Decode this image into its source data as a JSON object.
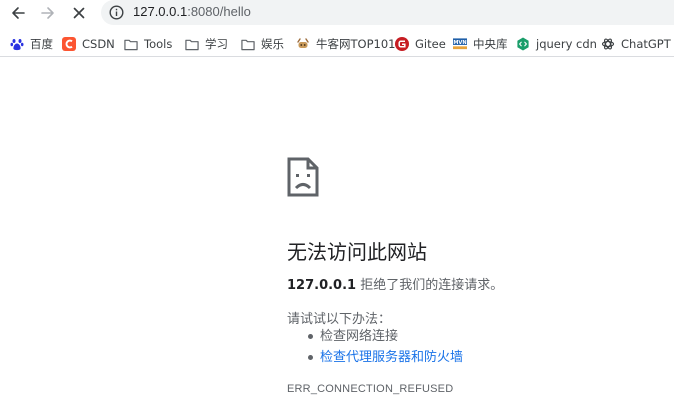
{
  "browser": {
    "url_host": "127.0.0.1",
    "url_port_path": ":8080/hello"
  },
  "bookmarks": [
    {
      "label": "百度",
      "icon": "baidu-paw-icon",
      "color": "#2932e1"
    },
    {
      "label": "CSDN",
      "icon": "csdn-logo-icon",
      "color": "#fc5531"
    },
    {
      "label": "Tools",
      "icon": "folder-icon",
      "color": "#5f6368"
    },
    {
      "label": "学习",
      "icon": "folder-icon",
      "color": "#5f6368"
    },
    {
      "label": "娱乐",
      "icon": "folder-icon",
      "color": "#5f6368"
    },
    {
      "label": "牛客网TOP101",
      "icon": "nowcoder-icon",
      "color": "#9c6b3b"
    },
    {
      "label": "Gitee",
      "icon": "gitee-logo-icon",
      "color": "#c71d23"
    },
    {
      "label": "中央库",
      "icon": "maven-logo-icon",
      "color": "#1f5fa8"
    },
    {
      "label": "jquery cdn",
      "icon": "jquery-cdn-icon",
      "color": "#1a9e6a"
    },
    {
      "label": "ChatGPT",
      "icon": "chatgpt-logo-icon",
      "color": "#3c4043"
    }
  ],
  "error_page": {
    "title": "无法访问此网站",
    "host": "127.0.0.1",
    "summary_suffix": " 拒绝了我们的连接请求。",
    "suggestions_intro": "请试试以下办法：",
    "suggestions": [
      {
        "label": "检查网络连接",
        "link": false
      },
      {
        "label": "检查代理服务器和防火墙",
        "link": true
      }
    ],
    "error_code": "ERR_CONNECTION_REFUSED"
  },
  "colors": {
    "link": "#1a73e8",
    "muted_text": "#5f6368",
    "omnibox_bg": "#f1f3f4"
  }
}
